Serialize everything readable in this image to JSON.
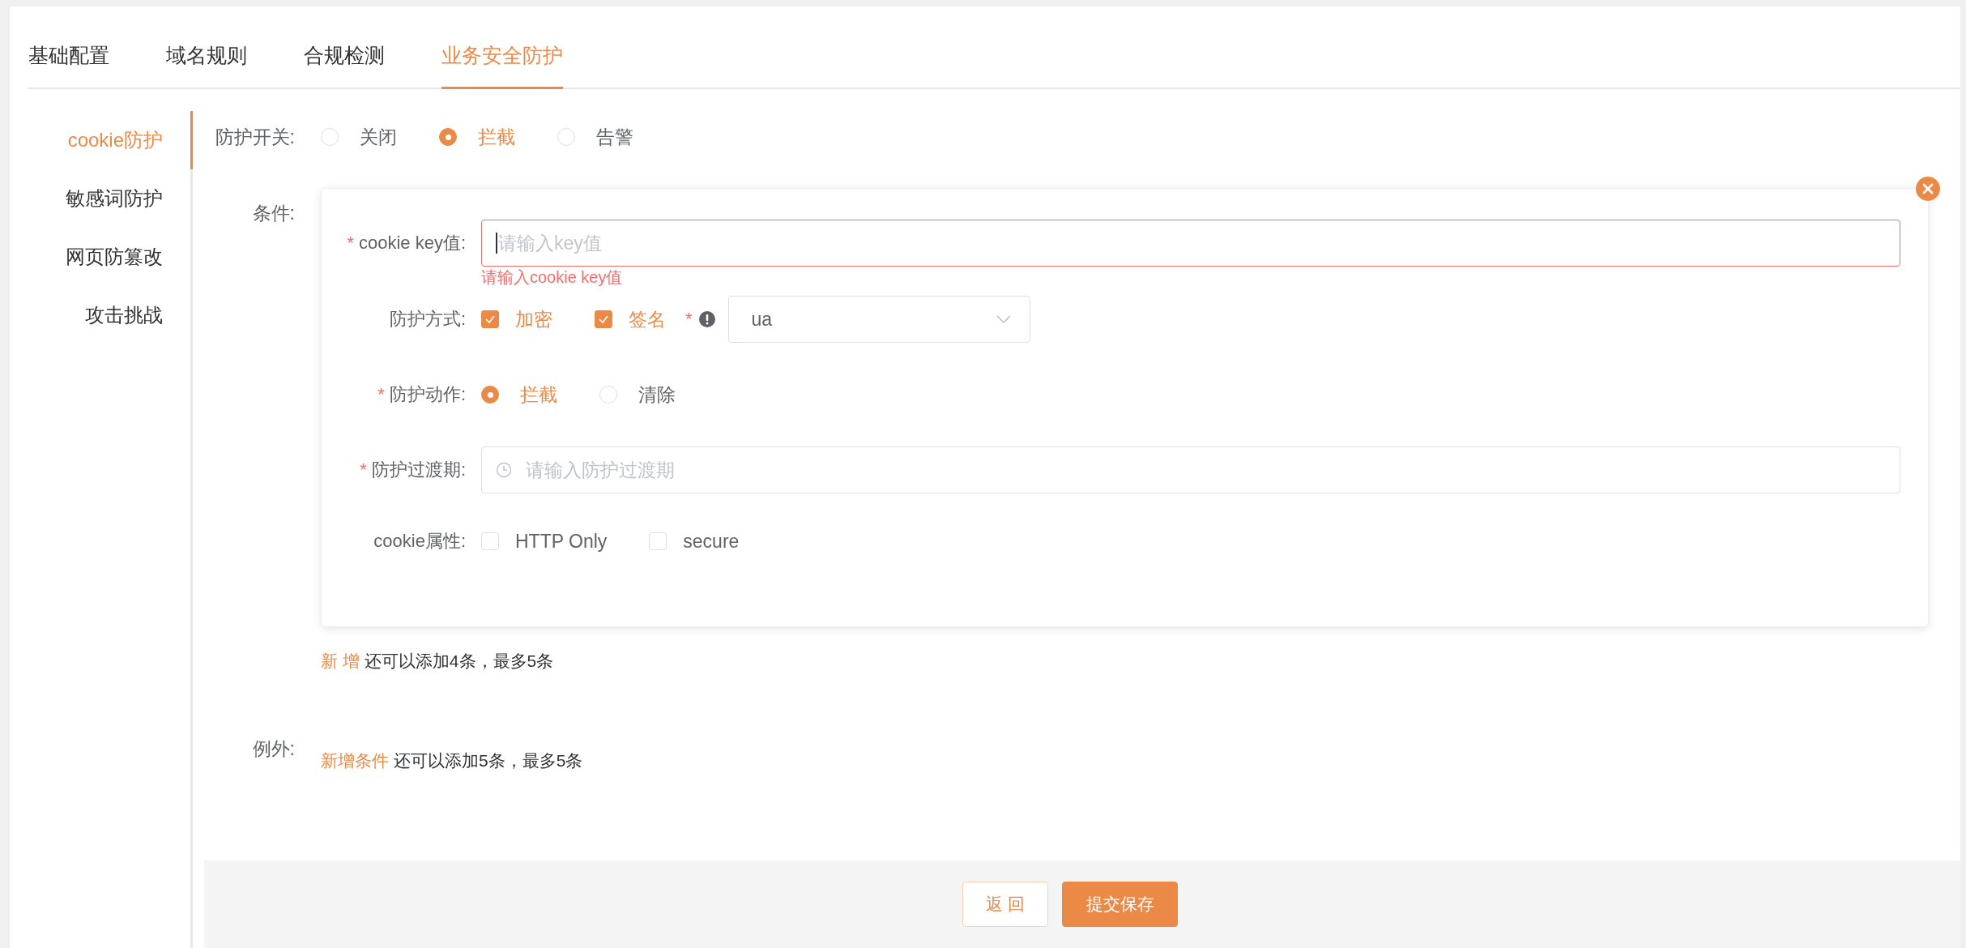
{
  "tabs": [
    {
      "label": "基础配置",
      "selected": false
    },
    {
      "label": "域名规则",
      "selected": false
    },
    {
      "label": "合规检测",
      "selected": false
    },
    {
      "label": "业务安全防护",
      "selected": true
    }
  ],
  "sidebar": {
    "items": [
      {
        "label": "cookie防护",
        "selected": true
      },
      {
        "label": "敏感词防护",
        "selected": false
      },
      {
        "label": "网页防篡改",
        "selected": false
      },
      {
        "label": "攻击挑战",
        "selected": false
      }
    ]
  },
  "protection_switch": {
    "label": "防护开关:",
    "options": [
      {
        "label": "关闭",
        "selected": false
      },
      {
        "label": "拦截",
        "selected": true
      },
      {
        "label": "告警",
        "selected": false
      }
    ]
  },
  "conditions": {
    "label": "条件:",
    "card": {
      "fields": [
        {
          "kind": "text",
          "required_mark": "*",
          "label": "cookie key值:",
          "placeholder": "请输入key值",
          "focused": true,
          "error": "请输入cookie key值"
        },
        {
          "kind": "checkboxes",
          "label": "防护方式:",
          "options": [
            {
              "label": "加密",
              "checked": true
            },
            {
              "label": "签名",
              "checked": true
            }
          ],
          "select": {
            "required_mark": "*",
            "value": "ua"
          }
        },
        {
          "kind": "radios",
          "required_mark": "*",
          "label": "防护动作:",
          "options": [
            {
              "label": "拦截",
              "selected": true
            },
            {
              "label": "清除",
              "selected": false
            }
          ]
        },
        {
          "kind": "time",
          "required_mark": "*",
          "label": "防护过渡期:",
          "placeholder": "请输入防护过渡期"
        },
        {
          "kind": "checkboxes",
          "label": "cookie属性:",
          "options": [
            {
              "label": "HTTP Only",
              "checked": false
            },
            {
              "label": "secure",
              "checked": false
            }
          ]
        }
      ]
    },
    "add_link": "新 增",
    "add_hint": "还可以添加4条，最多5条"
  },
  "exceptions": {
    "label": "例外:",
    "add_link": "新增条件",
    "add_hint": "还可以添加5条，最多5条"
  },
  "buttons": [
    {
      "label": "返 回",
      "kind": "secondary"
    },
    {
      "label": "提交保存",
      "kind": "primary"
    }
  ]
}
